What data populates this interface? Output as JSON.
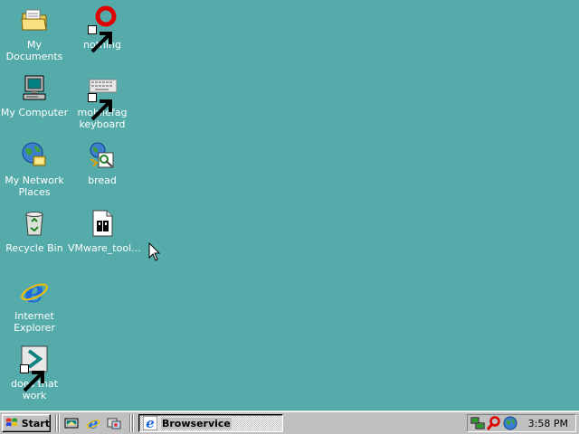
{
  "desktop": {
    "background_color": "#55aaaa",
    "icons": [
      {
        "label": "My Documents",
        "icon": "folder-documents-icon",
        "shortcut": false
      },
      {
        "label": "nothing",
        "icon": "red-ring-icon",
        "shortcut": true
      },
      {
        "label": "My Computer",
        "icon": "computer-icon",
        "shortcut": false
      },
      {
        "label": "mobilefag\nkeyboard",
        "icon": "keyboard-icon",
        "shortcut": true
      },
      {
        "label": "My Network\nPlaces",
        "icon": "network-places-icon",
        "shortcut": false
      },
      {
        "label": "bread",
        "icon": "bread-app-icon",
        "shortcut": false
      },
      {
        "label": "Recycle Bin",
        "icon": "recycle-bin-icon",
        "shortcut": false
      },
      {
        "label": "VMware_tool...",
        "icon": "installer-package-icon",
        "shortcut": false
      },
      {
        "label": "Internet\nExplorer",
        "icon": "internet-explorer-icon",
        "shortcut": false
      },
      {
        "label": "does that work",
        "icon": "arrow-app-icon",
        "shortcut": true
      }
    ]
  },
  "taskbar": {
    "start_label": "Start",
    "quick_launch": [
      "show-desktop-icon",
      "internet-explorer-icon",
      "channels-icon"
    ],
    "tasks": [
      {
        "label": "Browservice",
        "icon": "internet-explorer-icon",
        "active": true
      }
    ],
    "tray_icons": [
      "network-status-icon",
      "search-tray-icon",
      "globe-tray-icon"
    ],
    "clock": "3:58 PM"
  }
}
